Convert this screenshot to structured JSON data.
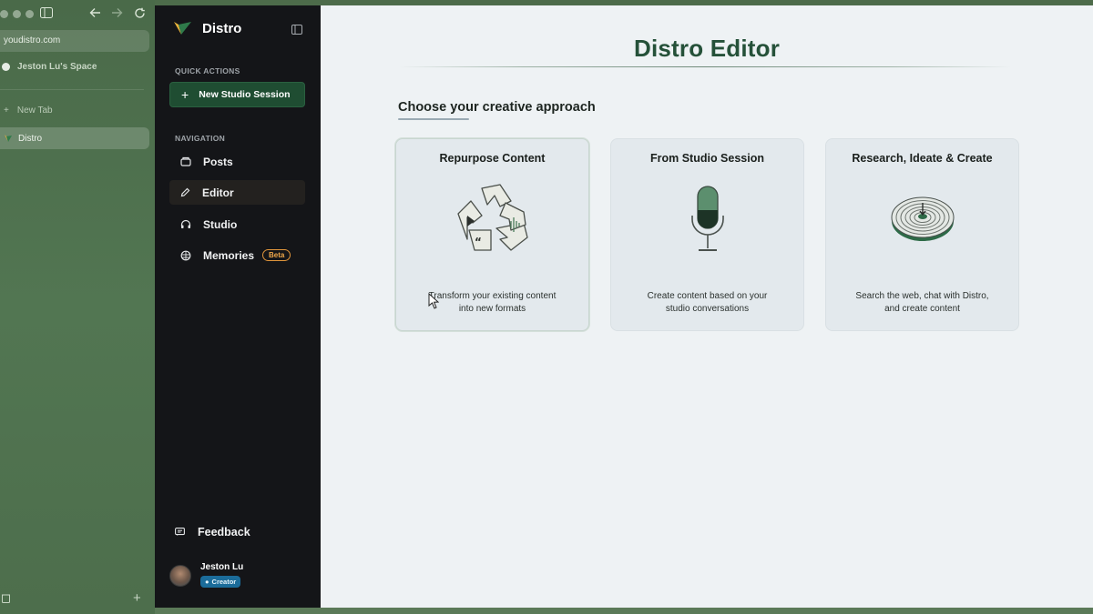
{
  "browser": {
    "url": "youdistro.com",
    "space_name": "Jeston Lu's Space",
    "new_tab_label": "New Tab",
    "active_tab_label": "Distro"
  },
  "app": {
    "brand": "Distro",
    "quick_actions_label": "QUICK ACTIONS",
    "new_session_label": "New Studio Session",
    "navigation_label": "NAVIGATION",
    "nav": [
      {
        "label": "Posts",
        "icon": "posts-icon"
      },
      {
        "label": "Editor",
        "icon": "pencil-icon"
      },
      {
        "label": "Studio",
        "icon": "headphones-icon"
      },
      {
        "label": "Memories",
        "icon": "brain-icon"
      }
    ],
    "beta_badge": "Beta",
    "feedback_label": "Feedback",
    "user": {
      "name": "Jeston Lu",
      "role": "Creator"
    }
  },
  "main": {
    "title": "Distro Editor",
    "subhead": "Choose your creative approach",
    "cards": [
      {
        "title": "Repurpose Content",
        "desc_line1": "Transform your existing content",
        "desc_line2": "into new formats"
      },
      {
        "title": "From Studio Session",
        "desc_line1": "Create content based on your",
        "desc_line2": "studio conversations"
      },
      {
        "title": "Research, Ideate & Create",
        "desc_line1": "Search the web, chat with Distro,",
        "desc_line2": "and create content"
      }
    ]
  },
  "colors": {
    "brand_green": "#255139",
    "nav_bg": "#141518",
    "session_button": "#1f4d32",
    "beta_orange": "#e0953b",
    "creator_blue": "#1b6c9a"
  }
}
